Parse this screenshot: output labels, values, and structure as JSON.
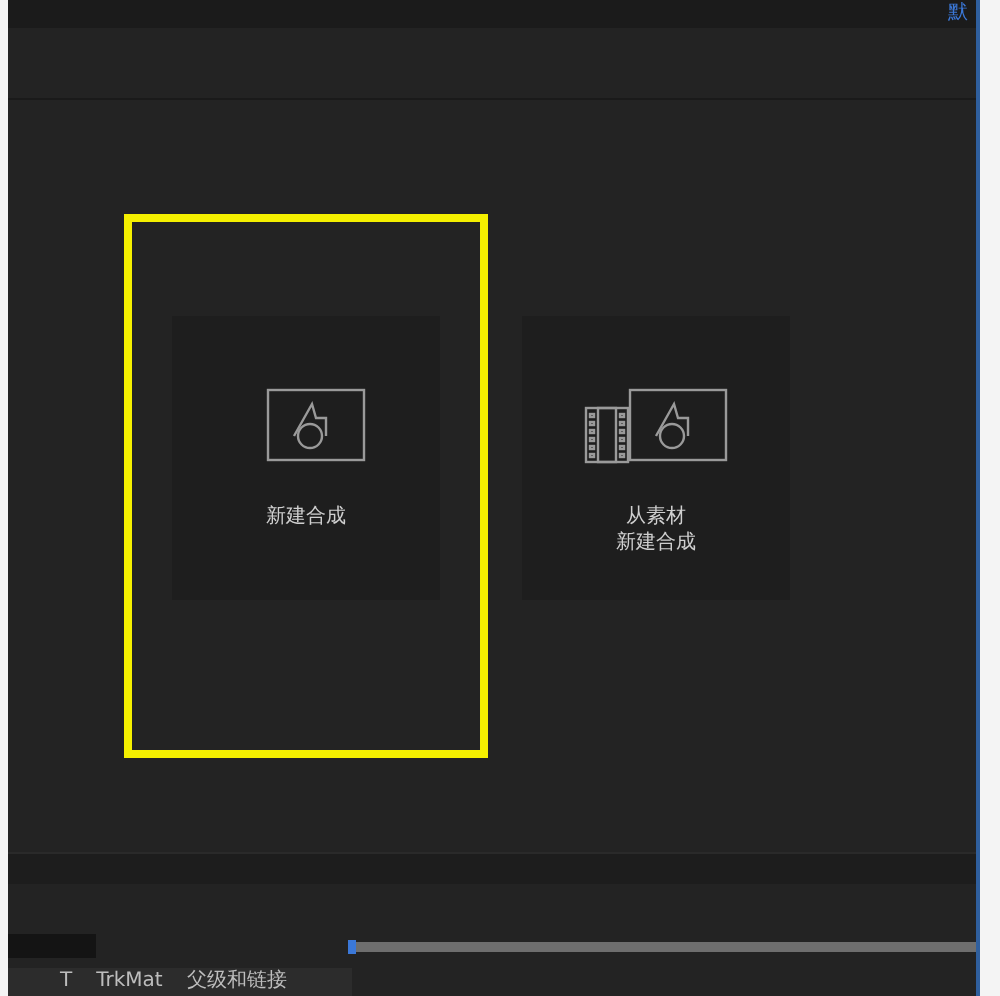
{
  "header": {
    "workspace": "默"
  },
  "cards": [
    {
      "kind": "new",
      "lines": [
        "新建合成"
      ],
      "highlighted": true
    },
    {
      "kind": "footage",
      "lines": [
        "从素材",
        "新建合成"
      ],
      "highlighted": false
    }
  ],
  "timeline": {
    "columns": [
      {
        "label": "T"
      },
      {
        "label": "TrkMat"
      },
      {
        "label": "父级和链接"
      }
    ]
  }
}
